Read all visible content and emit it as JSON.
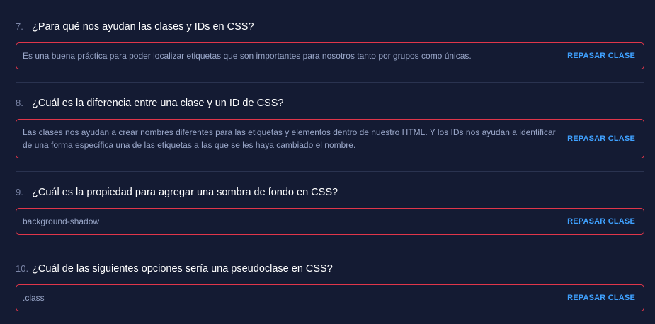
{
  "questions": [
    {
      "number": "7.",
      "question": "¿Para qué nos ayudan las clases y IDs en CSS?",
      "answer": "Es una buena práctica para poder localizar etiquetas que son importantes para nosotros tanto por grupos como únicas.",
      "action": "REPASAR CLASE"
    },
    {
      "number": "8.",
      "question": "¿Cuál es la diferencia entre una clase y un ID de CSS?",
      "answer": "Las clases nos ayudan a crear nombres diferentes para las etiquetas y elementos dentro de nuestro HTML. Y los IDs nos ayudan a identificar de una forma específica una de las etiquetas a las que se les haya cambiado el nombre.",
      "action": "REPASAR CLASE"
    },
    {
      "number": "9.",
      "question": "¿Cuál es la propiedad para agregar una sombra de fondo en CSS?",
      "answer": "background-shadow",
      "action": "REPASAR CLASE"
    },
    {
      "number": "10.",
      "question": "¿Cuál de las siguientes opciones sería una pseudoclase en CSS?",
      "answer": ".class",
      "action": "REPASAR CLASE"
    }
  ],
  "colors": {
    "background": "#141b33",
    "answer_border": "#e0364a",
    "link": "#3fa1ff",
    "answer_text": "#9aa7c9"
  }
}
